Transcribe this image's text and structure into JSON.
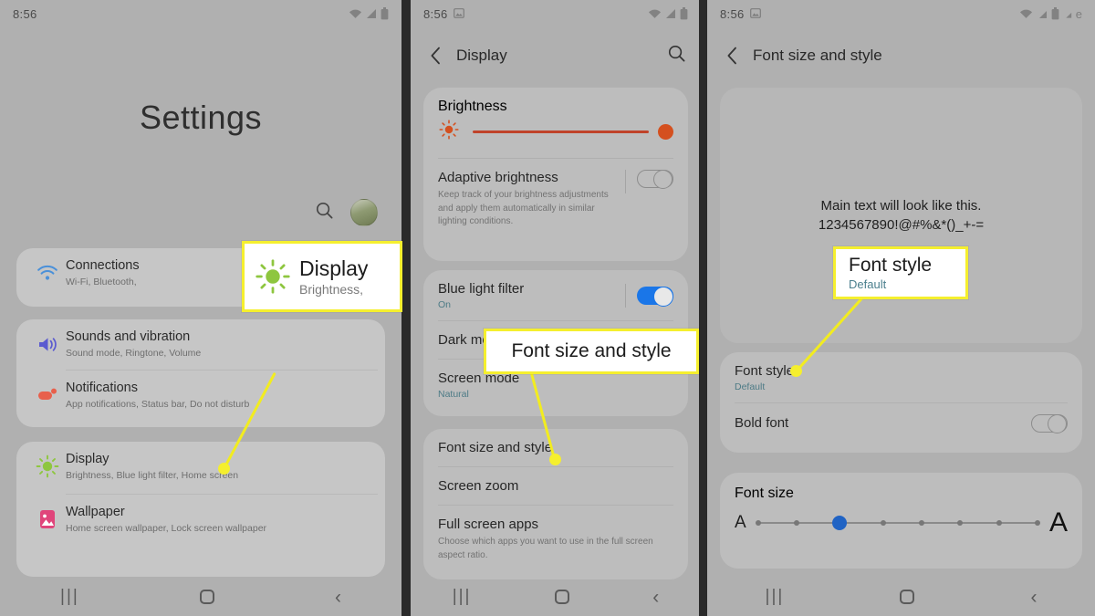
{
  "panel1": {
    "status": {
      "time": "8:56",
      "icons": [
        "wifi-icon",
        "signal-icon",
        "battery-icon"
      ]
    },
    "title": "Settings",
    "search_icon": "search-icon",
    "avatar": "account-avatar",
    "groups": [
      {
        "items": [
          {
            "title": "Connections",
            "sub": "Wi-Fi, Bluetooth, ",
            "icon": "wifi-icon",
            "color": "#4a90d9"
          }
        ]
      },
      {
        "items": [
          {
            "title": "Sounds and vibration",
            "sub": "Sound mode, Ringtone, Volume",
            "icon": "speaker-icon",
            "color": "#5a5ad0"
          },
          {
            "title": "Notifications",
            "sub": "App notifications, Status bar, Do not disturb",
            "icon": "notification-icon",
            "color": "#e8604c"
          }
        ]
      },
      {
        "items": [
          {
            "title": "Display",
            "sub": "Brightness, Blue light filter, Home screen",
            "icon": "brightness-icon",
            "color": "#8ec63f"
          },
          {
            "title": "Wallpaper",
            "sub": "Home screen wallpaper, Lock screen wallpaper",
            "icon": "wallpaper-icon",
            "color": "#e0457b"
          }
        ]
      }
    ],
    "nav": {
      "recents": "|||",
      "home": "home-icon",
      "back": "‹"
    }
  },
  "panel2": {
    "status": {
      "time": "8:56",
      "image_icon": "image-icon",
      "icons": [
        "wifi-icon",
        "signal-icon",
        "battery-icon"
      ]
    },
    "appbar": {
      "back": "back-arrow-icon",
      "title": "Display",
      "search": "search-icon"
    },
    "brightness": {
      "label": "Brightness",
      "icon": "brightness-icon",
      "value_percent": 100,
      "track_color": "#c0432a",
      "thumb_color": "#d4501f"
    },
    "adaptive": {
      "title": "Adaptive brightness",
      "desc": "Keep track of your brightness adjustments and apply them automatically in similar lighting conditions.",
      "toggle": "off"
    },
    "blue_light": {
      "title": "Blue light filter",
      "sub": "On",
      "toggle": "on",
      "toggle_color": "#1a76e8"
    },
    "dark_mode": {
      "title": "Dark mode"
    },
    "screen_mode": {
      "title": "Screen mode",
      "sub": "Natural"
    },
    "font_size_and_style": {
      "title": "Font size and style"
    },
    "screen_zoom": {
      "title": "Screen zoom"
    },
    "full_screen_apps": {
      "title": "Full screen apps",
      "desc": "Choose which apps you want to use in the full screen aspect ratio."
    },
    "nav": {
      "recents": "|||",
      "home": "home-icon",
      "back": "‹"
    }
  },
  "panel3": {
    "status": {
      "time": "8:56",
      "image_icon": "image-icon",
      "icons": [
        "wifi-icon",
        "signal-icon",
        "battery-icon"
      ],
      "network": "e"
    },
    "appbar": {
      "back": "back-arrow-icon",
      "title": "Font size and style"
    },
    "preview": {
      "line1": "Main text will look like this.",
      "line2": "1234567890!@#%&*()_+-="
    },
    "font_style": {
      "title": "Font style",
      "sub": "Default"
    },
    "bold_font": {
      "title": "Bold font",
      "toggle": "off"
    },
    "font_size": {
      "title": "Font size",
      "small_label": "A",
      "large_label": "A",
      "steps": 8,
      "selected_index": 2,
      "thumb_color": "#2063c4"
    },
    "nav": {
      "recents": "|||",
      "home": "home-icon",
      "back": "‹"
    }
  },
  "callouts": {
    "display": {
      "title": "Display",
      "sub": "Brightness,",
      "icon": "brightness-icon",
      "border_color": "#f5ef2e"
    },
    "font_size_and_style": {
      "title": "Font size and style",
      "border_color": "#f5ef2e"
    },
    "font_style": {
      "title": "Font style",
      "sub": "Default",
      "border_color": "#f5ef2e"
    }
  }
}
